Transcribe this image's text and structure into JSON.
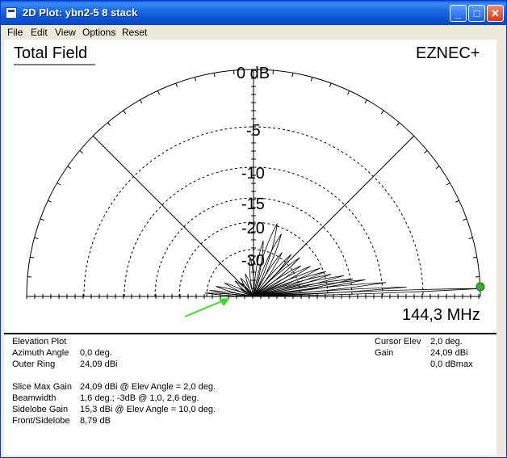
{
  "window": {
    "title": "2D Plot: ybn2-5 8 stack"
  },
  "menu": [
    "File",
    "Edit",
    "View",
    "Options",
    "Reset"
  ],
  "plot": {
    "title": "Total Field",
    "brand": "EZNEC+",
    "frequency": "144,3 MHz",
    "ring_labels": [
      "0 dB",
      "-5",
      "-10",
      "-15",
      "-20",
      "-30"
    ]
  },
  "info": {
    "plot_type": "Elevation Plot",
    "azimuth_label": "Azimuth Angle",
    "azimuth_value": "0,0 deg.",
    "outer_ring_label": "Outer Ring",
    "outer_ring_value": "24,09 dBi",
    "slice_max_label": "Slice Max Gain",
    "slice_max_value": "24,09 dBi @ Elev Angle = 2,0 deg.",
    "beamwidth_label": "Beamwidth",
    "beamwidth_value": "1,6 deg.; -3dB @ 1,0, 2,6 deg.",
    "sidelobe_label": "Sidelobe Gain",
    "sidelobe_value": "15,3 dBi @ Elev Angle = 10,0 deg.",
    "fs_label": "Front/Sidelobe",
    "fs_value": "8,79 dB",
    "cursor_label": "Cursor Elev",
    "cursor_value": "2,0 deg.",
    "gain_label": "Gain",
    "gain_value": "24,09 dBi",
    "dbmax_value": "0,0 dBmax"
  }
}
